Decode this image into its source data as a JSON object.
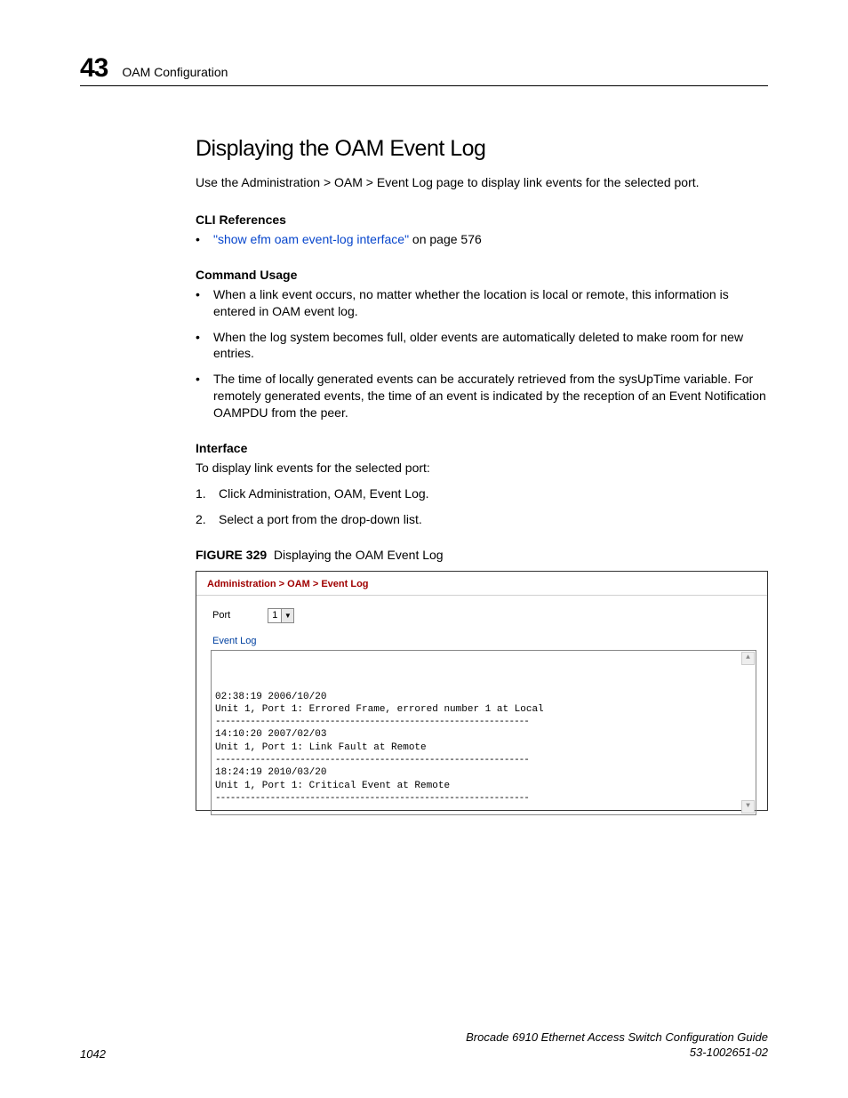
{
  "header": {
    "chapter_number": "43",
    "chapter_title": "OAM Configuration"
  },
  "section": {
    "title": "Displaying the OAM Event Log",
    "intro": "Use the Administration > OAM > Event Log page to display link events for the selected port."
  },
  "cli": {
    "heading": "CLI References",
    "link_text": "\"show efm oam event-log interface\"",
    "link_suffix": " on page 576"
  },
  "usage": {
    "heading": "Command Usage",
    "items": [
      "When a link event occurs, no matter whether the location is local or remote, this information is entered in OAM event log.",
      "When the log system becomes full, older events are automatically deleted to make room for new entries.",
      "The time of locally generated events can be accurately retrieved from the sysUpTime variable. For remotely generated events, the time of an event is indicated by the reception of an Event Notification OAMPDU from the peer."
    ]
  },
  "interface": {
    "heading": "Interface",
    "intro": "To display link events for the selected port:",
    "steps": [
      "Click Administration, OAM, Event Log.",
      "Select a port from the drop-down list."
    ]
  },
  "figure": {
    "label": "FIGURE 329",
    "caption": "Displaying the OAM Event Log"
  },
  "screenshot": {
    "breadcrumb": "Administration > OAM > Event Log",
    "port_label": "Port",
    "port_value": "1",
    "eventlog_label": "Event Log",
    "log_lines": [
      "02:38:19 2006/10/20",
      "Unit 1, Port 1: Errored Frame, errored number 1 at Local",
      "---------------------------------------------------------------",
      "14:10:20 2007/02/03",
      "Unit 1, Port 1: Link Fault at Remote",
      "---------------------------------------------------------------",
      "18:24:19 2010/03/20",
      "Unit 1, Port 1: Critical Event at Remote",
      "---------------------------------------------------------------"
    ]
  },
  "footer": {
    "page": "1042",
    "guide": "Brocade 6910 Ethernet Access Switch Configuration Guide",
    "docnum": "53-1002651-02"
  }
}
